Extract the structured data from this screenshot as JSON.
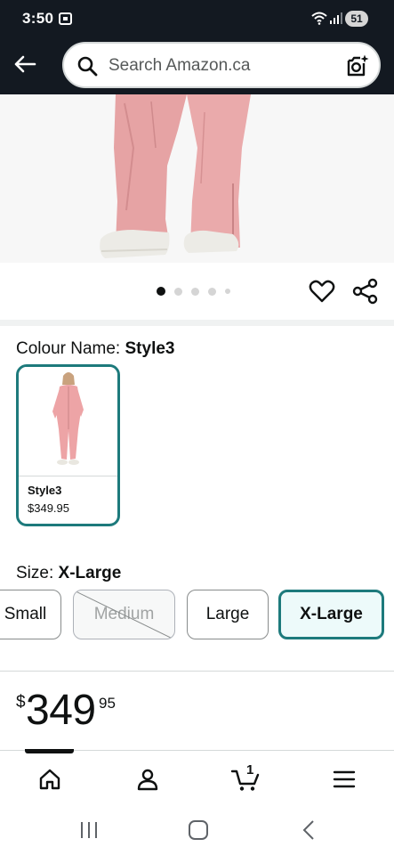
{
  "status_bar": {
    "time": "3:50",
    "battery": "51"
  },
  "header": {
    "search_placeholder": "Search Amazon.ca"
  },
  "carousel": {
    "total_images": 5,
    "active_index": 0
  },
  "colour": {
    "label": "Colour Name: ",
    "selected": "Style3",
    "swatches": [
      {
        "name": "Style3",
        "price": "$349.95",
        "selected": true
      }
    ]
  },
  "size": {
    "label": "Size: ",
    "selected": "X-Large",
    "options": [
      {
        "label": "Small",
        "available": true
      },
      {
        "label": "Medium",
        "available": false
      },
      {
        "label": "Large",
        "available": true
      },
      {
        "label": "X-Large",
        "available": true,
        "selected": true
      }
    ]
  },
  "price": {
    "symbol": "$",
    "whole": "349",
    "fraction": "95"
  },
  "bottom_nav": {
    "cart_count": "1",
    "items": [
      "home-icon",
      "account-icon",
      "cart-icon",
      "menu-icon"
    ]
  },
  "colors": {
    "header_bg": "#131921",
    "selected_border": "#1d7a7c",
    "selected_bg": "#edfafa"
  }
}
